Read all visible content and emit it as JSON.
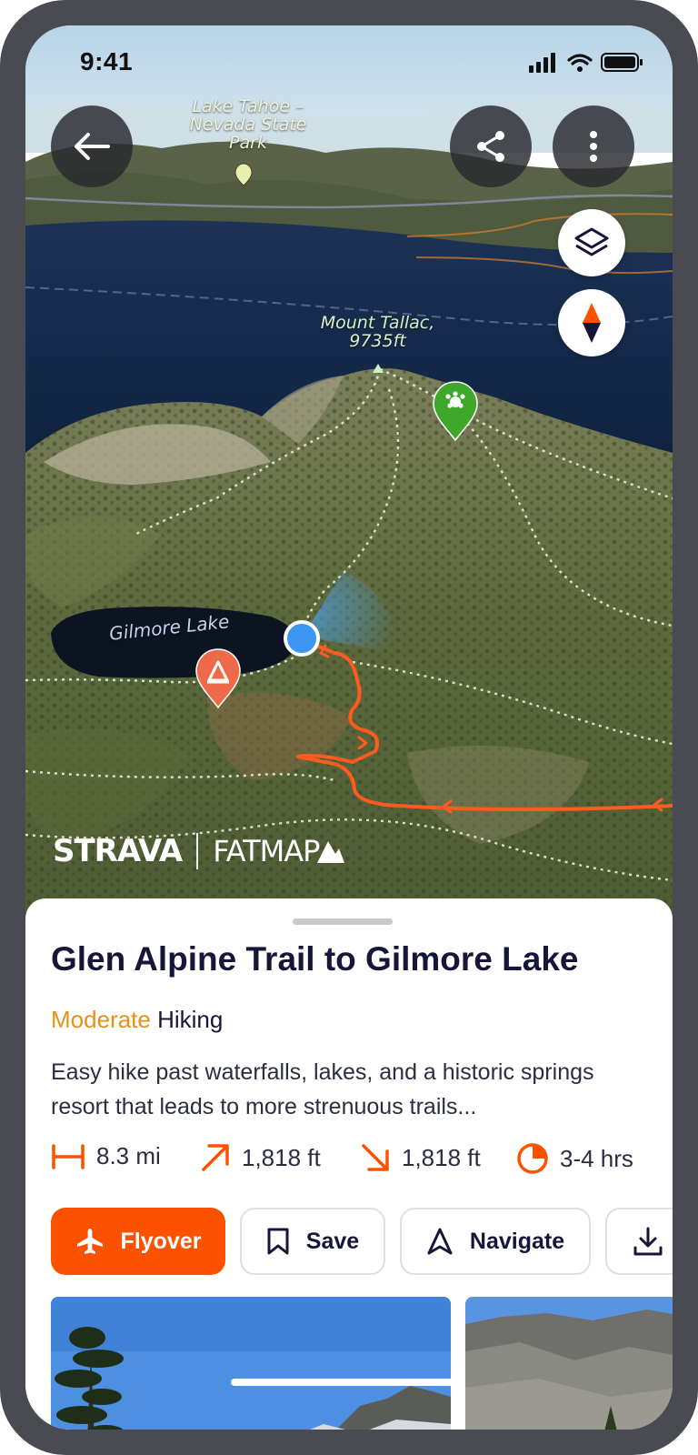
{
  "status_bar": {
    "time": "9:41"
  },
  "map": {
    "labels": {
      "park": "Lake Tahoe – Nevada State Park",
      "park_line1": "Lake Tahoe –",
      "park_line2": "Nevada State",
      "park_line3": "Park",
      "peak_line1": "Mount Tallac,",
      "peak_line2": "9735ft",
      "lake": "Gilmore Lake"
    },
    "brand": {
      "strava": "STRAVA",
      "fatmap": "FATMAP"
    },
    "controls": {
      "back_icon": "arrow-left-icon",
      "share_icon": "share-icon",
      "more_icon": "more-vertical-icon",
      "layers_icon": "layers-icon",
      "compass_icon": "compass-icon"
    }
  },
  "trail": {
    "title": "Glen Alpine Trail to Gilmore Lake",
    "difficulty": "Moderate",
    "activity": "Hiking",
    "description": "Easy hike past waterfalls, lakes, and a historic springs resort that leads to more strenuous trails...",
    "stats": {
      "distance": "8.3 mi",
      "elevation_gain": "1,818 ft",
      "elevation_loss": "1,818 ft",
      "duration": "3-4 hrs"
    }
  },
  "actions": {
    "flyover": "Flyover",
    "save": "Save",
    "navigate": "Navigate"
  },
  "colors": {
    "accent": "#fc5200",
    "moderate": "#e8901a",
    "title": "#15173a"
  }
}
